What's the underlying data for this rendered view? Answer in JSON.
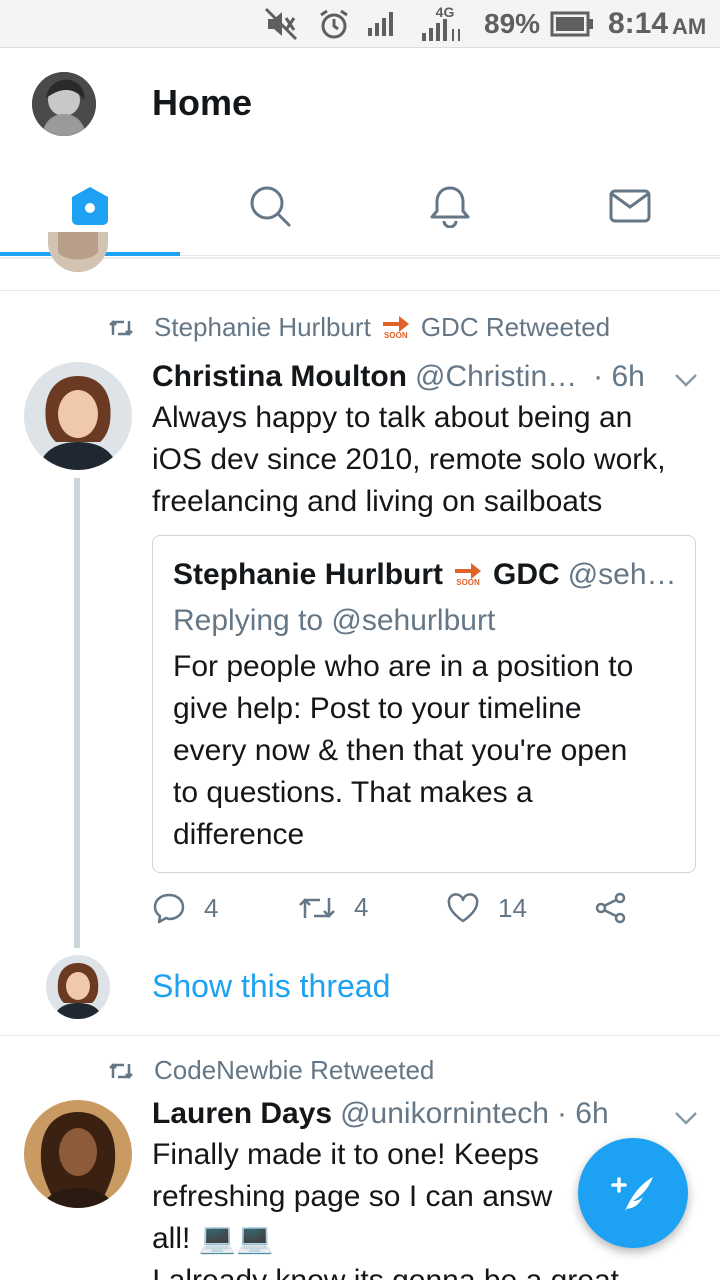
{
  "status_bar": {
    "network": "4G",
    "battery": "89%",
    "time": "8:14",
    "ampm": "AM"
  },
  "header": {
    "title": "Home"
  },
  "tabs": [
    {
      "name": "home",
      "icon": "home-icon",
      "active": true
    },
    {
      "name": "search",
      "icon": "search-icon",
      "active": false
    },
    {
      "name": "notifications",
      "icon": "bell-icon",
      "active": false
    },
    {
      "name": "messages",
      "icon": "mail-icon",
      "active": false
    }
  ],
  "tweets": [
    {
      "retweeted_by": "Stephanie Hurlburt",
      "retweeted_by_suffix": "GDC Retweeted",
      "badge": "SOON",
      "name": "Christina Moulton",
      "handle": "@Christin…",
      "time": "· 6h",
      "text_lines": [
        "Always happy to talk about being an",
        "iOS dev since 2010, remote solo work,",
        "freelancing and living on sailboats"
      ],
      "quote": {
        "name": "Stephanie Hurlburt",
        "name_suffix": "GDC",
        "handle": "@seh…",
        "reply": "Replying to @sehurlburt",
        "text_lines": [
          "For people who are in a position to",
          "give help: Post to your timeline",
          "every now & then that you're open",
          "to questions. That makes a",
          "difference"
        ]
      },
      "replies": "4",
      "retweets": "4",
      "likes": "14",
      "show_thread": "Show this thread"
    },
    {
      "retweeted_by": "CodeNewbie Retweeted",
      "name": "Lauren Days",
      "handle": "@unikornintech",
      "time": "· 6h",
      "text_lines": [
        "Finally made it to one! Keeps",
        "refreshing page so I can answ",
        "all! 💻💻",
        "I already know its gonna be a great"
      ]
    }
  ],
  "colors": {
    "accent": "#1da1f2",
    "secondary_text": "#657786",
    "primary_text": "#14171a",
    "border": "#e1e8ed"
  }
}
